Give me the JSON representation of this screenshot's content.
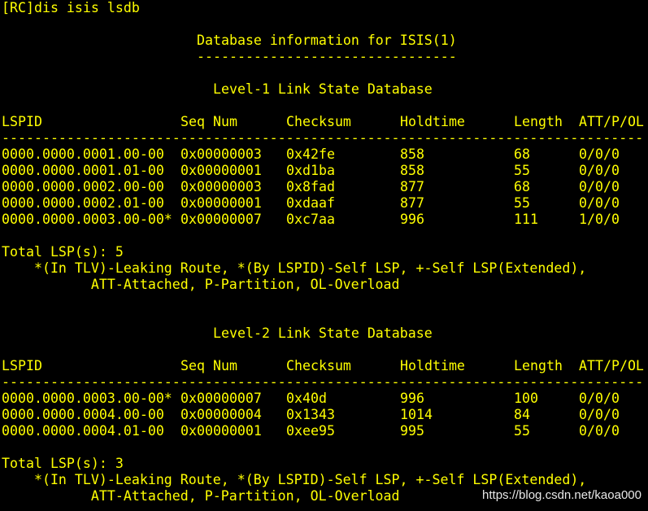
{
  "terminal": {
    "prompt": "[RC]dis isis lsdb",
    "header": {
      "title": "Database information for ISIS(1)",
      "underline": "--------------------------------"
    },
    "levels": [
      {
        "title": "Level-1 Link State Database",
        "columns": [
          "LSPID",
          "Seq Num",
          "Checksum",
          "Holdtime",
          "Length",
          "ATT/P/OL"
        ],
        "separator": "-------------------------------------------------------------------------------",
        "rows": [
          [
            "0000.0000.0001.00-00",
            "0x00000003",
            "0x42fe",
            "858",
            "68",
            "0/0/0"
          ],
          [
            "0000.0000.0001.01-00",
            "0x00000001",
            "0xd1ba",
            "858",
            "55",
            "0/0/0"
          ],
          [
            "0000.0000.0002.00-00",
            "0x00000003",
            "0x8fad",
            "877",
            "68",
            "0/0/0"
          ],
          [
            "0000.0000.0002.01-00",
            "0x00000001",
            "0xdaaf",
            "877",
            "55",
            "0/0/0"
          ],
          [
            "0000.0000.0003.00-00*",
            "0x00000007",
            "0xc7aa",
            "996",
            "111",
            "1/0/0"
          ]
        ],
        "total": "Total LSP(s): 5",
        "legend_line1": "    *(In TLV)-Leaking Route, *(By LSPID)-Self LSP, +-Self LSP(Extended),",
        "legend_line2": "           ATT-Attached, P-Partition, OL-Overload"
      },
      {
        "title": "Level-2 Link State Database",
        "columns": [
          "LSPID",
          "Seq Num",
          "Checksum",
          "Holdtime",
          "Length",
          "ATT/P/OL"
        ],
        "separator": "-------------------------------------------------------------------------------",
        "rows": [
          [
            "0000.0000.0003.00-00*",
            "0x00000007",
            "0x40d",
            "996",
            "100",
            "0/0/0"
          ],
          [
            "0000.0000.0004.00-00",
            "0x00000004",
            "0x1343",
            "1014",
            "84",
            "0/0/0"
          ],
          [
            "0000.0000.0004.01-00",
            "0x00000001",
            "0xee95",
            "995",
            "55",
            "0/0/0"
          ]
        ],
        "total": "Total LSP(s): 3",
        "legend_line1": "    *(In TLV)-Leaking Route, *(By LSPID)-Self LSP, +-Self LSP(Extended),",
        "legend_line2": "           ATT-Attached, P-Partition, OL-Overload"
      }
    ]
  },
  "watermark": "https://blog.csdn.net/kaoa000",
  "colors": {
    "background": "#000000",
    "text": "#ffff00",
    "watermark": "#e8e8e8"
  }
}
